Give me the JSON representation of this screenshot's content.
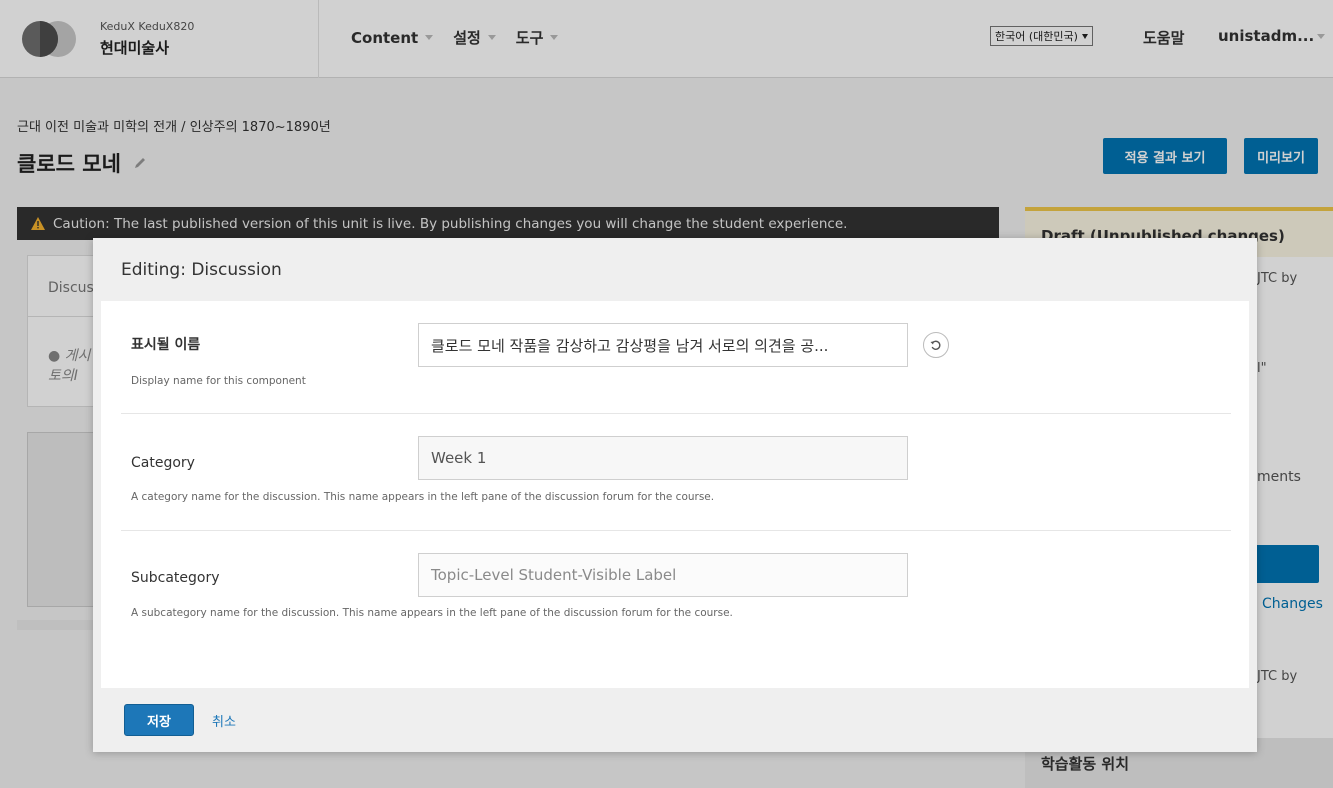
{
  "header": {
    "course_org": "KeduX KeduX820",
    "course_name": "현대미술사",
    "nav": [
      {
        "label": "Content"
      },
      {
        "label": "설정"
      },
      {
        "label": "도구"
      }
    ],
    "language": "한국어 (대한민국)",
    "help": "도움말",
    "user": "unistadm..."
  },
  "page": {
    "breadcrumb": "근대 이전 미술과 미학의 전개  /  인상주의 1870~1890년",
    "title": "클로드 모네",
    "view_live_button": "적용 결과 보기",
    "preview_button": "미리보기",
    "caution": "Caution: The last published version of this unit is live. By publishing changes you will change the student experience."
  },
  "background": {
    "component_label": "Discus",
    "component_preview_1": "게시",
    "component_preview_2": "토의I"
  },
  "sidebar": {
    "status_title": "Draft (Unpublished changes)",
    "frag_1": "JTC by",
    "frag_2": "l\"",
    "frag_3": "ments",
    "link": "Changes",
    "frag_4": "JTC by",
    "footer_title": "학습활동 위치"
  },
  "modal": {
    "title": "Editing: Discussion",
    "fields": [
      {
        "label": "표시될 이름",
        "value": "클로드 모네 작품을 감상하고 감상평을 남겨 서로의 의견을 공...",
        "help": "Display name for this component"
      },
      {
        "label": "Category",
        "value": "Week 1",
        "help": "A category name for the discussion. This name appears in the left pane of the discussion forum for the course."
      },
      {
        "label": "Subcategory",
        "value": "Topic-Level Student-Visible Label",
        "help": "A subcategory name for the discussion. This name appears in the left pane of the discussion forum for the course."
      }
    ],
    "save_label": "저장",
    "cancel_label": "취소"
  },
  "colors": {
    "primary": "#0075b4",
    "caution_bg": "#333333",
    "draft_accent": "#f0c74a"
  }
}
